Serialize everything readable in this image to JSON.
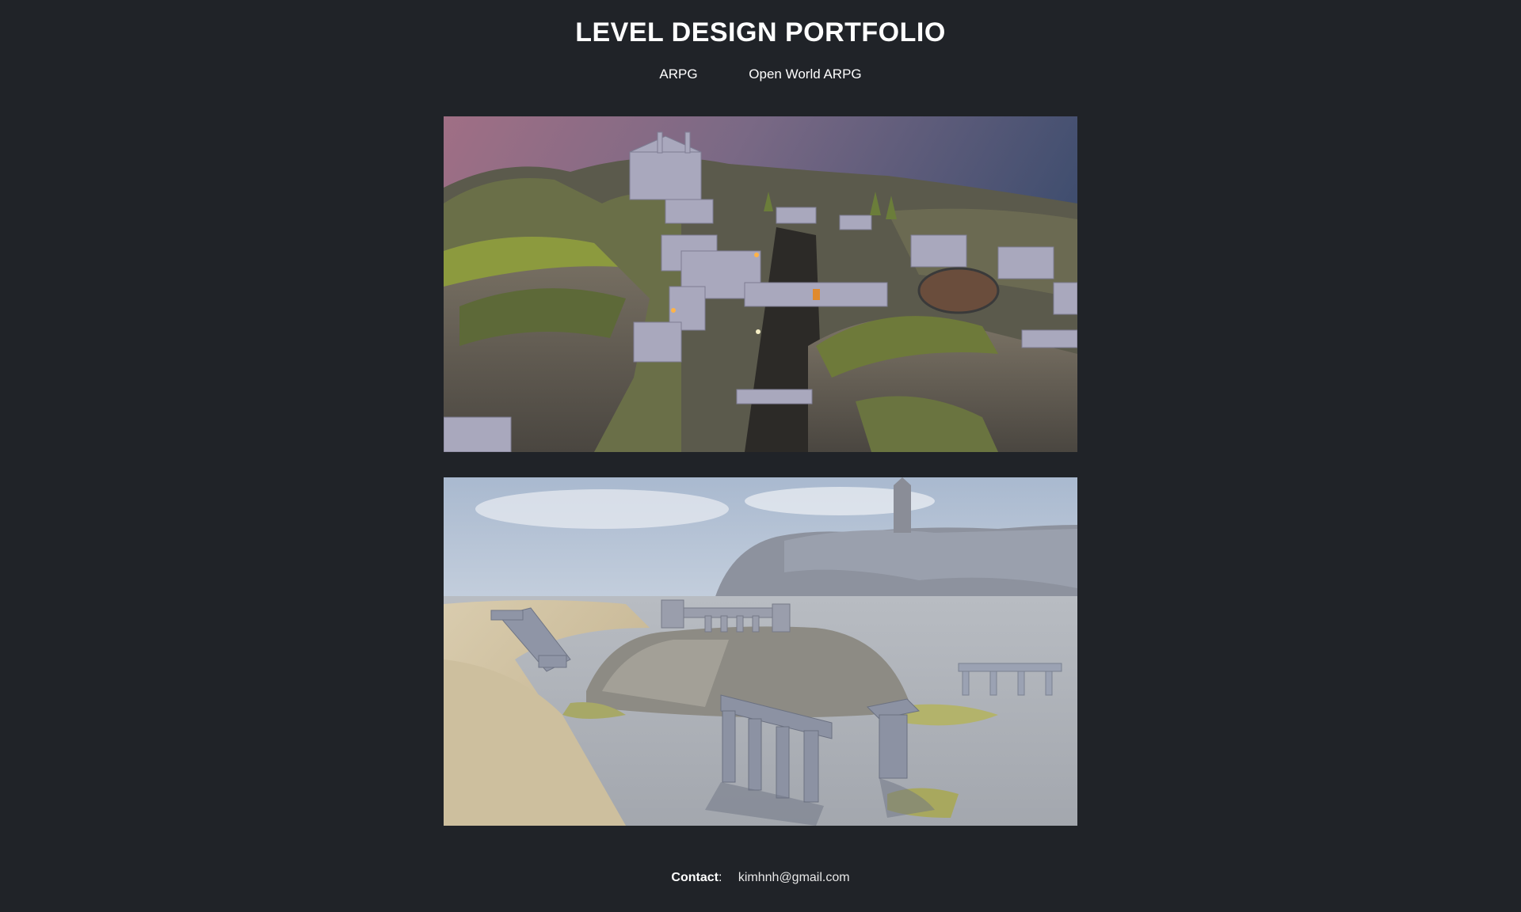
{
  "header": {
    "title": "LEVEL DESIGN PORTFOLIO"
  },
  "nav": {
    "items": [
      {
        "label": "ARPG"
      },
      {
        "label": "Open World ARPG"
      }
    ]
  },
  "gallery": {
    "images": [
      {
        "subject": "arpg-cliff-castle-level"
      },
      {
        "subject": "open-world-ruins-level"
      }
    ]
  },
  "footer": {
    "contact_label": "Contact",
    "contact_sep": ":",
    "email": "kimhnh@gmail.com"
  }
}
